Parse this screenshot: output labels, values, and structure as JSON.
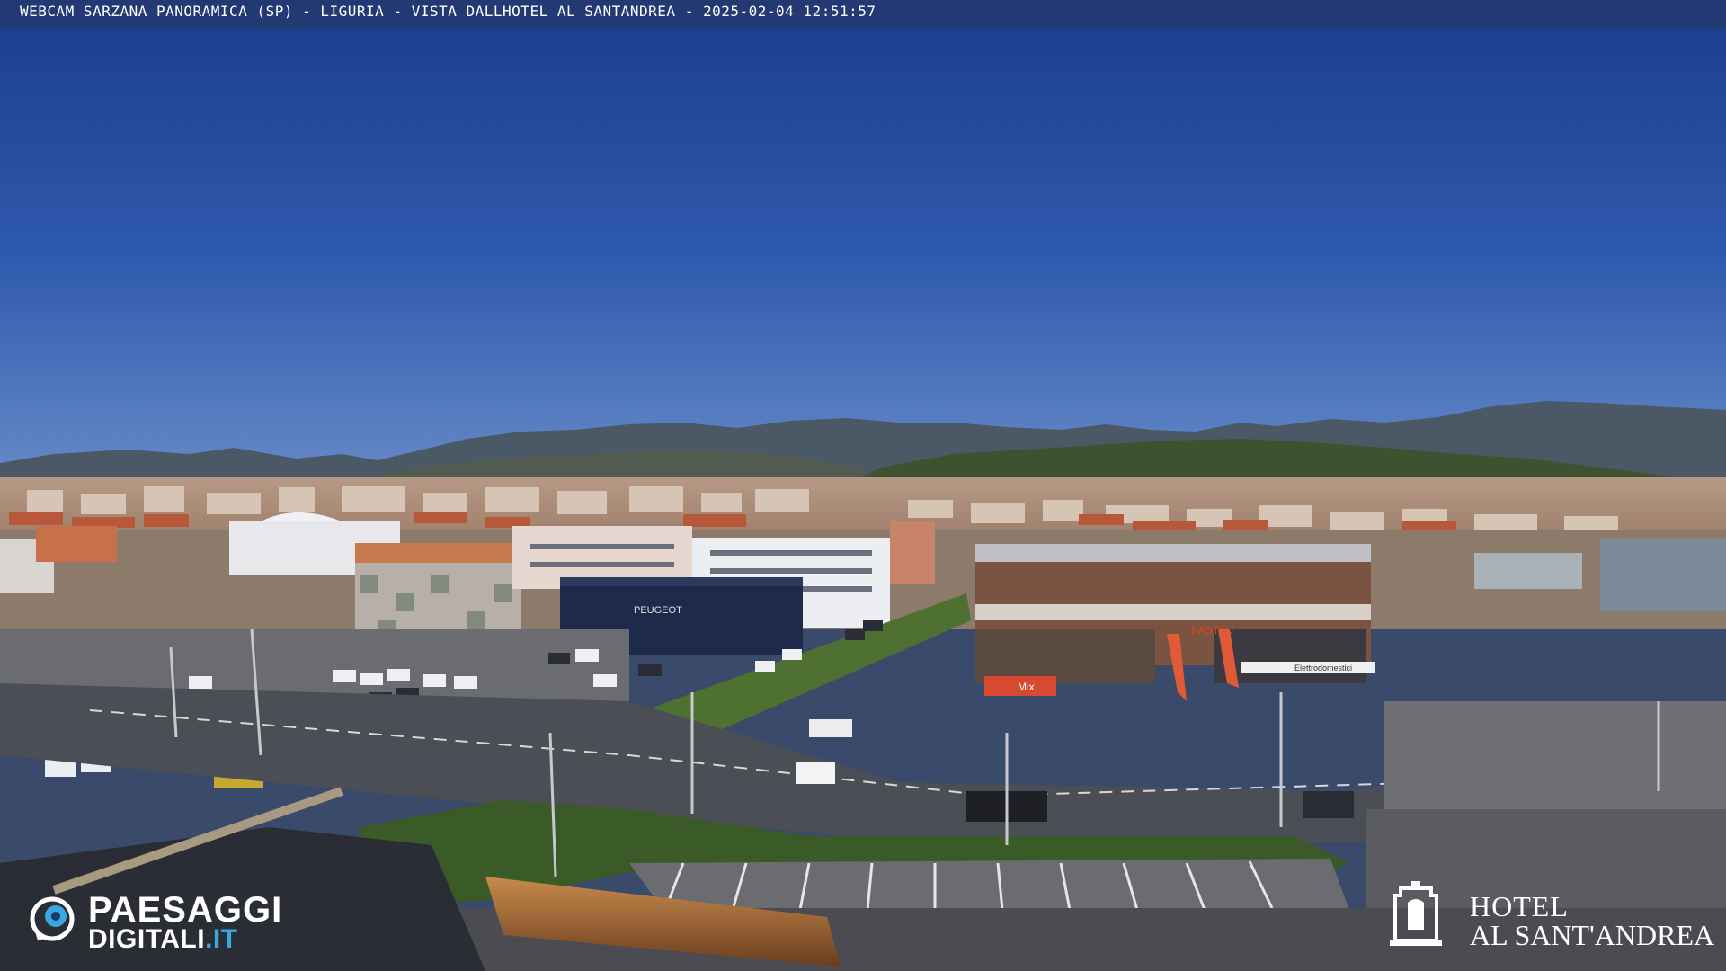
{
  "overlay": {
    "title": "WEBCAM SARZANA PANORAMICA (SP) - LIGURIA - VISTA DALLHOTEL AL SANTANDREA - 2025-02-04  12:51:57"
  },
  "branding": {
    "left_logo_line1": "PAESAGGI",
    "left_logo_line2": "DIGITALI",
    "left_logo_suffix": ".IT",
    "right_logo_line1": "HOTEL",
    "right_logo_line2": "AL SANT'ANDREA"
  },
  "signs": {
    "dealer": "PEUGEOT",
    "store": "KASTAU",
    "store2": "Mix",
    "store3": "Elettrodomestici"
  },
  "colors": {
    "sky_top": "#1d3f8f",
    "sky_bottom": "#5a7ec0",
    "hills": "#3b4a4a",
    "road": "#4a4c52"
  }
}
